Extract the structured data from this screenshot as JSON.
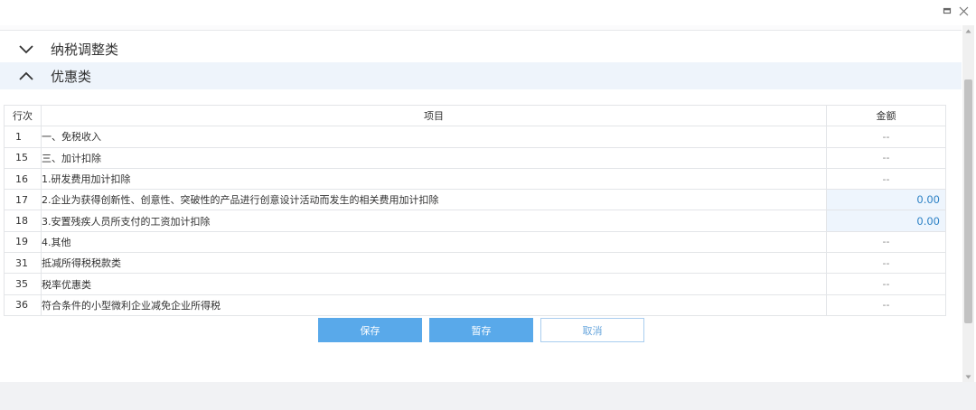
{
  "sections": {
    "collapsed": {
      "label": "纳税调整类"
    },
    "expanded": {
      "label": "优惠类"
    }
  },
  "table": {
    "headers": {
      "row_no": "行次",
      "item": "项目",
      "amount": "金额"
    },
    "rows": [
      {
        "row_no": "1",
        "item": "一、免税收入",
        "amount": "--",
        "indent": 0,
        "editable": false
      },
      {
        "row_no": "15",
        "item": "三、加计扣除",
        "amount": "--",
        "indent": 0,
        "editable": false
      },
      {
        "row_no": "16",
        "item": "1.研发费用加计扣除",
        "amount": "--",
        "indent": 1,
        "editable": false
      },
      {
        "row_no": "17",
        "item": "2.企业为获得创新性、创意性、突破性的产品进行创意设计活动而发生的相关费用加计扣除",
        "amount": "0.00",
        "indent": 1,
        "editable": true
      },
      {
        "row_no": "18",
        "item": "3.安置残疾人员所支付的工资加计扣除",
        "amount": "0.00",
        "indent": 1,
        "editable": true
      },
      {
        "row_no": "19",
        "item": "4.其他",
        "amount": "--",
        "indent": 1,
        "editable": false
      },
      {
        "row_no": "31",
        "item": "抵减所得税税款类",
        "amount": "--",
        "indent": 2,
        "editable": false
      },
      {
        "row_no": "35",
        "item": "税率优惠类",
        "amount": "--",
        "indent": 2,
        "editable": false
      },
      {
        "row_no": "36",
        "item": "符合条件的小型微利企业减免企业所得税",
        "amount": "--",
        "indent": 3,
        "editable": false
      }
    ]
  },
  "buttons": {
    "save": "保存",
    "temp_save": "暂存",
    "cancel": "取消"
  },
  "colors": {
    "primary": "#59a9ea",
    "amount_value": "#2e82c6",
    "editable_bg": "#eef5fd",
    "header_bg": "#eef4fb"
  }
}
